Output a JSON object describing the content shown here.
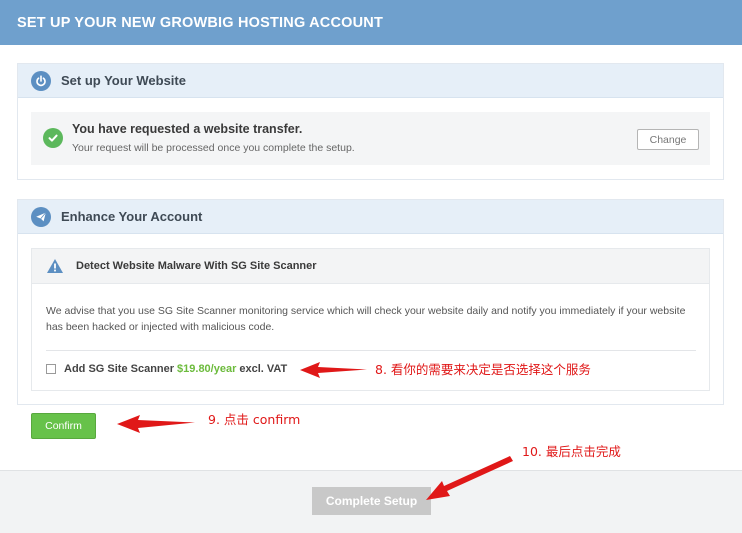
{
  "header": {
    "title": "SET UP YOUR NEW GROWBIG HOSTING ACCOUNT"
  },
  "setup_panel": {
    "title": "Set up Your Website",
    "icon": "power-icon",
    "transfer": {
      "title": "You have requested a website transfer.",
      "subtitle": "Your request will be processed once you complete the setup.",
      "change_label": "Change"
    }
  },
  "enhance_panel": {
    "title": "Enhance Your Account",
    "icon": "paper-plane-icon",
    "scanner": {
      "title": "Detect Website Malware With SG Site Scanner",
      "description": "We advise that you use SG Site Scanner monitoring service which will check your website daily and notify you immediately if your website has been hacked or injected with malicious code.",
      "addon_label": "Add SG Site Scanner",
      "price": "$19.80/year",
      "price_suffix": "excl. VAT",
      "checked": false
    }
  },
  "actions": {
    "confirm_label": "Confirm",
    "complete_label": "Complete Setup"
  },
  "annotations": {
    "note8": "8. 看你的需要来决定是否选择这个服务",
    "note9": "9. 点击 confirm",
    "note10": "10. 最后点击完成"
  },
  "colors": {
    "header": "#6fa0cd",
    "accent_green": "#67c24a",
    "price_green": "#6cbb3c",
    "annotation_red": "#e01818"
  }
}
